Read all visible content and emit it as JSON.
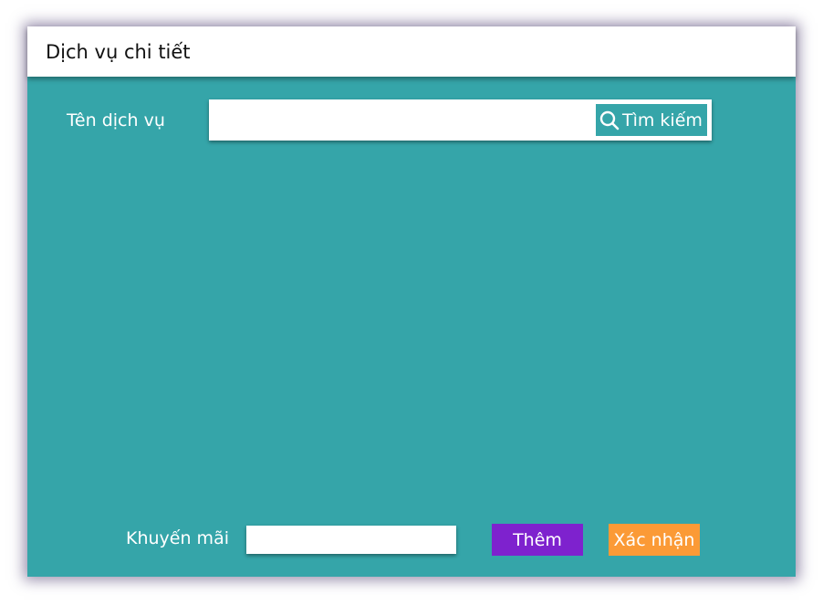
{
  "window": {
    "title": "Dịch vụ chi tiết"
  },
  "search": {
    "label": "Tên dịch vụ",
    "value": "",
    "button_label": "Tìm kiếm",
    "button_icon": "search-icon"
  },
  "footer": {
    "promo_label": "Khuyến mãi",
    "promo_value": "",
    "add_label": "Thêm",
    "confirm_label": "Xác nhận"
  },
  "colors": {
    "background": "#35a5a9",
    "add_button": "#7e22ce",
    "confirm_button": "#fb9a36",
    "window_shadow": "#48386e"
  }
}
